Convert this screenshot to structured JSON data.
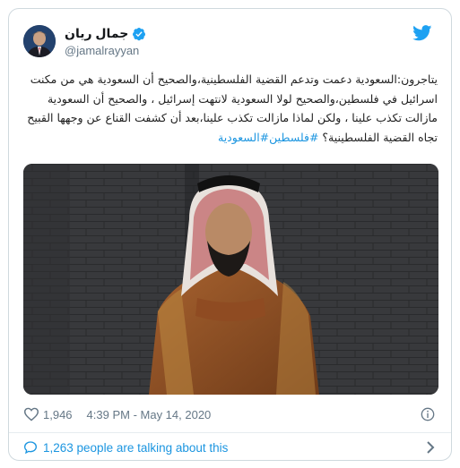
{
  "author": {
    "display_name": "جمال ريان",
    "handle": "@jamalrayyan",
    "verified": true
  },
  "tweet": {
    "lines": [
      "يتاجرون:السعودية دعمت وتدعم القضية الفلسطينية،والصحيح أن السعودية هي من مكنت",
      "اسرائيل في فلسطين،والصحيح لولا السعودية لانتهت إسرائيل ، والصحيح أن السعودية",
      "مازالت تكذب علينا ، ولكن لماذا مازالت تكذب علينا،بعد أن كشفت القناع عن وجهها القبيح",
      "تجاه القضية الفلسطينية؟"
    ],
    "hashtags": [
      "#فلسطين",
      "#السعودية"
    ]
  },
  "footer": {
    "likes": "1,946",
    "time": "4:39 PM - May 14, 2020",
    "conversation_label": "1,263 people are talking about this"
  },
  "icons": {
    "logo": "twitter-bird-icon",
    "verified": "verified-badge-icon",
    "like": "heart-icon",
    "info": "info-icon",
    "reply": "speech-bubble-icon",
    "more": "chevron-right-icon"
  },
  "colors": {
    "brand": "#1da1f2",
    "link": "#1b95e0",
    "muted": "#657786",
    "border": "#cfd9de"
  }
}
